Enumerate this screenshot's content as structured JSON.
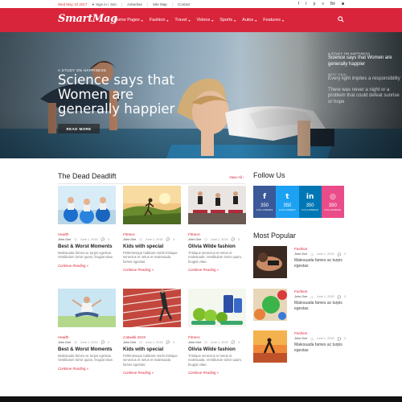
{
  "topbar": {
    "date": "Wed May 10 2017",
    "links": [
      "Sign in / Join",
      "Advertise",
      "Site Map",
      "Contact"
    ],
    "social_icons": [
      "facebook-icon",
      "twitter-icon",
      "pinterest-icon",
      "vimeo-icon",
      "behance-icon",
      "instagram-icon"
    ]
  },
  "header": {
    "logo": "SmartMag",
    "nav": [
      "Home Pages",
      "Fashion",
      "Travel",
      "Videos",
      "Sports",
      "Autos",
      "Features"
    ],
    "accent_color": "#d9253b"
  },
  "hero": {
    "category": "A STUDY ON HAPPINESS",
    "title": "Science says that Women are generally happier",
    "button": "READ MORE",
    "side_stories": [
      {
        "category": "A STUDY ON HAPPINESS",
        "title": "Science says that Women are generally happier"
      },
      {
        "category": "BEST DEAL",
        "title": "Every light implies a responsibility"
      },
      {
        "category": "",
        "title": "There was never a night or a problem that could defeat sunrise or hope"
      }
    ]
  },
  "main": {
    "section_title": "The Dead Deadlift",
    "view_all": "View All ›",
    "cards": [
      {
        "category": "Health",
        "author": "John Doe",
        "date": "June 1, 2015",
        "comments": "0",
        "title": "Best & Worst Moments",
        "excerpt": "Malesuada fames ac turpis egestas. Vestibulum tortor quam, feugiat vitae.",
        "more": "Continue Reading »"
      },
      {
        "category": "Fitness",
        "author": "John Doe",
        "date": "June 1, 2015",
        "comments": "0",
        "title": "Kids with special",
        "excerpt": "Pellentesque habitant morbi tristique senectus et netus et malesuada fames egestas.",
        "more": "Continue Reading »"
      },
      {
        "category": "Fitness",
        "author": "John Doe",
        "date": "June 1, 2015",
        "comments": "0",
        "title": "Olivia Wilde fashion",
        "excerpt": "Tristique senectus et netus et malesuada. Vestibulum tortor quam, feugiat vitae.",
        "more": "Continue Reading »"
      },
      {
        "category": "Health",
        "author": "John Doe",
        "date": "June 1, 2015",
        "comments": "0",
        "title": "Best & Worst Moments",
        "excerpt": "Malesuada fames ac turpis egestas. Vestibulum tortor quam, feugiat vitae.",
        "more": "Continue Reading »"
      },
      {
        "category": "Catwalk 2015",
        "author": "John Doe",
        "date": "June 1, 2015",
        "comments": "0",
        "title": "Kids with special",
        "excerpt": "Pellentesque habitant morbi tristique senectus et netus et malesuada fames egestas.",
        "more": "Continue Reading »"
      },
      {
        "category": "Fitness",
        "author": "John Doe",
        "date": "June 1, 2015",
        "comments": "0",
        "title": "Olivia Wilde fashion",
        "excerpt": "Tristique senectus et netus et malesuada. Vestibulum tortor quam, feugiat vitae.",
        "more": "Continue Reading »"
      }
    ]
  },
  "sidebar": {
    "follow_title": "Follow Us",
    "follow": [
      {
        "icon": "f",
        "name": "facebook-icon",
        "count": "350",
        "label": "FOLLOWERS",
        "color": "#3b5998"
      },
      {
        "icon": "t",
        "name": "twitter-icon",
        "count": "350",
        "label": "FOLLOWERS",
        "color": "#1da1f2"
      },
      {
        "icon": "in",
        "name": "linkedin-icon",
        "count": "350",
        "label": "FOLLOWERS",
        "color": "#0077b5"
      },
      {
        "icon": "◎",
        "name": "dribbble-icon",
        "count": "350",
        "label": "FOLLOWERS",
        "color": "#ea4c89"
      }
    ],
    "popular_title": "Most Popular",
    "popular": [
      {
        "category": "Fashion",
        "author": "John Doe",
        "date": "June 1, 2015",
        "comments": "0",
        "title": "Malesuada fames ac turpis egestas"
      },
      {
        "category": "Fashion",
        "author": "John Doe",
        "date": "June 1, 2015",
        "comments": "0",
        "title": "Malesuada fames ac turpis egestas"
      },
      {
        "category": "Fashion",
        "author": "John Doe",
        "date": "June 1, 2015",
        "comments": "0",
        "title": "Malesuada fames ac turpis egestas"
      }
    ]
  }
}
